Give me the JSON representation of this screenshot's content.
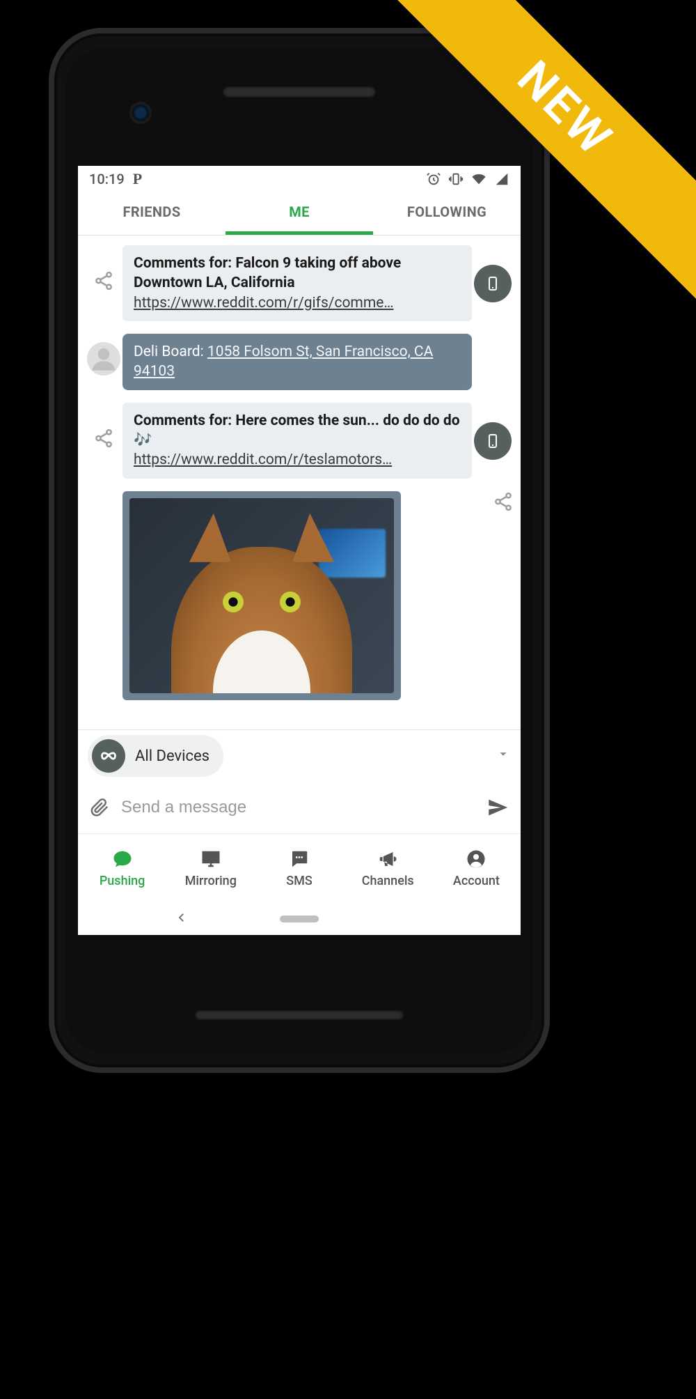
{
  "ribbon": {
    "label": "NEW"
  },
  "statusbar": {
    "time": "10:19"
  },
  "tabs": {
    "items": [
      {
        "label": "FRIENDS",
        "active": false
      },
      {
        "label": "ME",
        "active": true
      },
      {
        "label": "FOLLOWING",
        "active": false
      }
    ]
  },
  "thread": {
    "messages": [
      {
        "kind": "link-card",
        "title": "Comments for: Falcon 9 taking off above Downtown LA, California",
        "url": "https://www.reddit.com/r/gifs/comme…"
      },
      {
        "kind": "contact-card",
        "title_prefix": "Deli Board: ",
        "address": "1058 Folsom St, San Francisco, CA 94103"
      },
      {
        "kind": "link-card",
        "title": "Comments for: Here comes the sun... do do do do 🎶",
        "url": "https://www.reddit.com/r/teslamotors…"
      },
      {
        "kind": "image",
        "alt": "Photo of a tabby cat indoors"
      }
    ]
  },
  "compose": {
    "target_label": "All Devices",
    "placeholder": "Send a message"
  },
  "bottomnav": {
    "items": [
      {
        "label": "Pushing",
        "icon": "chat-bubble-icon",
        "active": true
      },
      {
        "label": "Mirroring",
        "icon": "monitor-icon",
        "active": false
      },
      {
        "label": "SMS",
        "icon": "sms-icon",
        "active": false
      },
      {
        "label": "Channels",
        "icon": "megaphone-icon",
        "active": false
      },
      {
        "label": "Account",
        "icon": "account-circle-icon",
        "active": false
      }
    ]
  }
}
